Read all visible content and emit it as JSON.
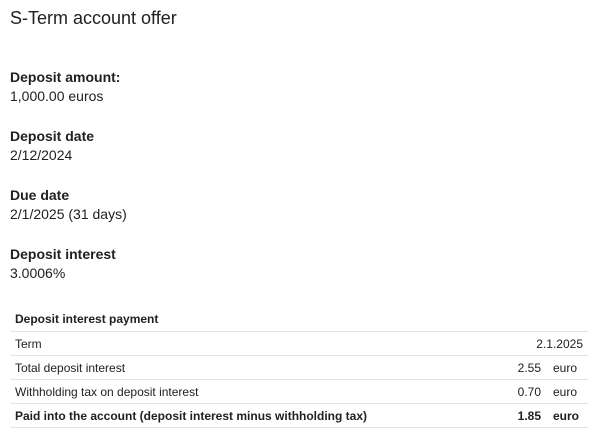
{
  "page": {
    "title": "S-Term account offer"
  },
  "fields": [
    {
      "label": "Deposit amount:",
      "value": "1,000.00 euros"
    },
    {
      "label": "Deposit date",
      "value": "2/12/2024"
    },
    {
      "label": "Due date",
      "value": "2/1/2025 (31 days)"
    },
    {
      "label": "Deposit interest",
      "value": "3.0006%"
    }
  ],
  "table": {
    "header": "Deposit interest payment",
    "rows": [
      {
        "label": "Term",
        "value": "2.1.2025",
        "unit": ""
      },
      {
        "label": "Total deposit interest",
        "value": "2.55",
        "unit": "euro"
      },
      {
        "label": "Withholding tax on deposit interest",
        "value": "0.70",
        "unit": "euro"
      },
      {
        "label": "Paid into the account (deposit interest minus withholding tax)",
        "value": "1.85",
        "unit": "euro"
      }
    ]
  }
}
